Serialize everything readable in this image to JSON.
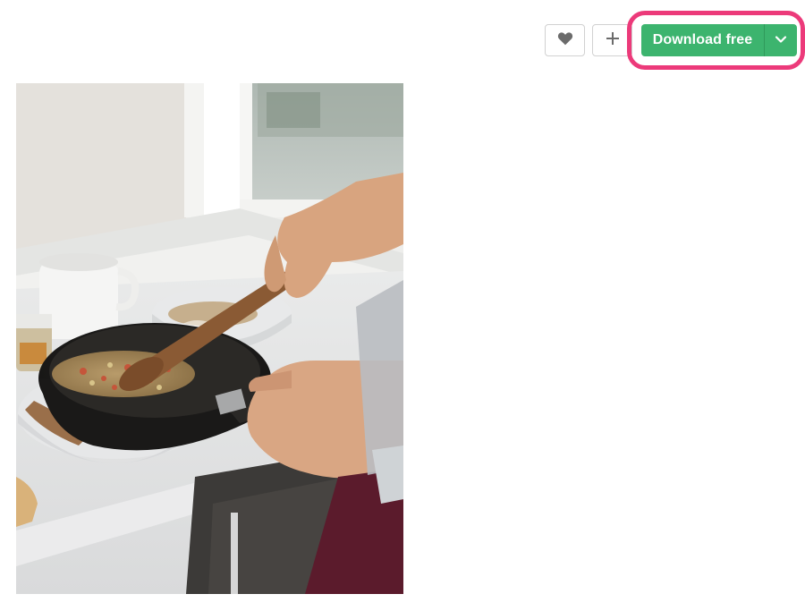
{
  "actions": {
    "like_icon": "heart-icon",
    "collect_icon": "plus-icon",
    "download_label": "Download free",
    "download_menu_icon": "chevron-down-icon",
    "download_color": "#3cb46e",
    "highlight_color": "#ec3a7a"
  },
  "photo": {
    "subject": "photo"
  }
}
